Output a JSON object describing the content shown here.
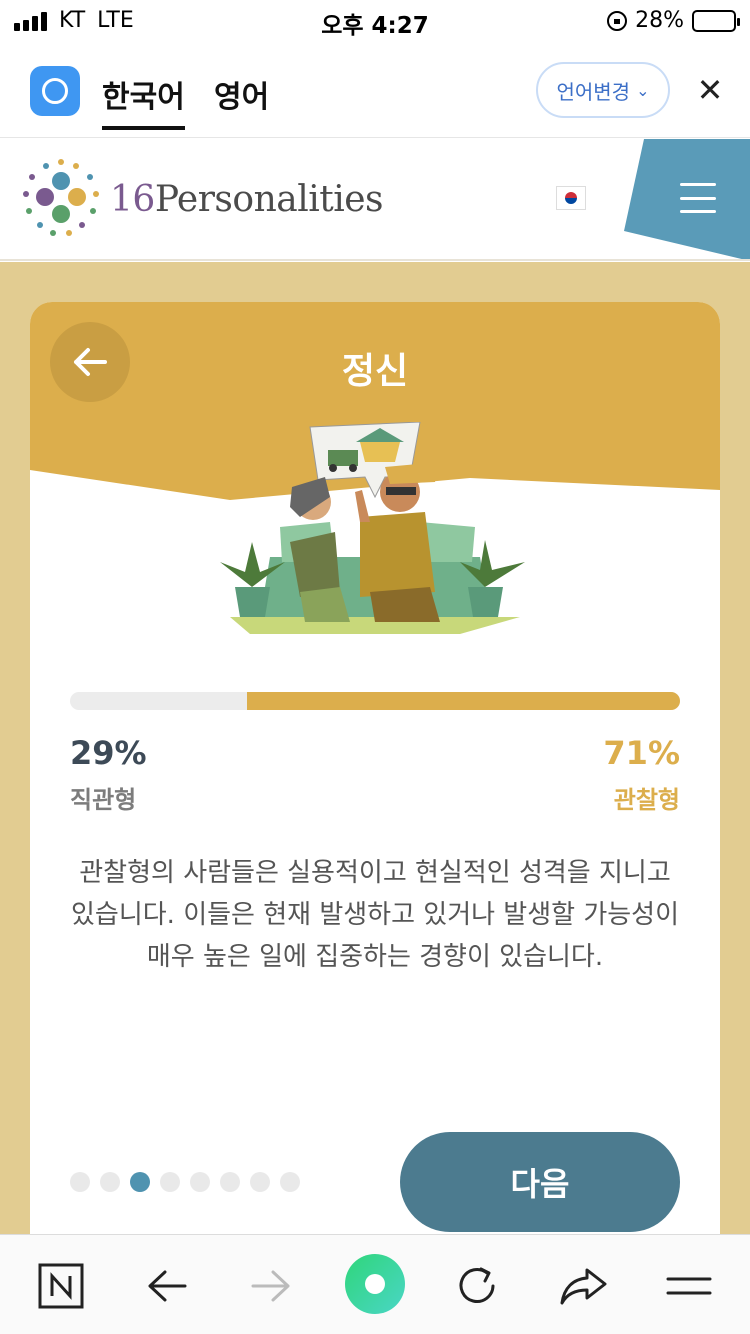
{
  "status_bar": {
    "carrier": "KT",
    "network": "LTE",
    "time": "오후 4:27",
    "battery": "28%",
    "battery_level": 0.28
  },
  "translator": {
    "tabs": [
      "한국어",
      "영어"
    ],
    "active_tab": "한국어",
    "change_language": "언어변경"
  },
  "site": {
    "logo_number": "16",
    "logo_word": "Personalities"
  },
  "card": {
    "title": "정신",
    "trait_left": {
      "percent": "29%",
      "label": "직관형",
      "value": 0.29
    },
    "trait_right": {
      "percent": "71%",
      "label": "관찰형",
      "value": 0.71
    },
    "description": "관찰형의 사람들은 실용적이고 현실적인 성격을 지니고 있습니다. 이들은 현재 발생하고 있거나 발생할 가능성이 매우 높은 일에 집중하는 경향이 있습니다.",
    "next_label": "다음",
    "page_count": 8,
    "current_page": 3
  },
  "colors": {
    "page_bg": "#e2cc91",
    "card_header": "#dcae4c",
    "accent": "#dcae4c",
    "menu_tab": "#5a9bb8",
    "next_button": "#4c7b8f",
    "active_dot": "#4f93b0"
  },
  "toolbar_icons": [
    "naver-n-icon",
    "back-arrow-icon",
    "forward-arrow-icon",
    "home-circle-icon",
    "refresh-icon",
    "share-icon",
    "menu-icon"
  ]
}
